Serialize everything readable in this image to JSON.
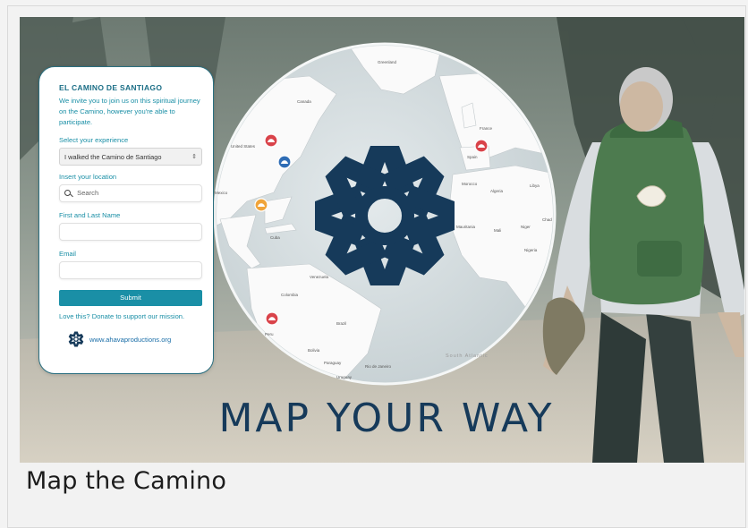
{
  "caption": "Map the Camino",
  "headline": "MAP YOUR WAY",
  "form": {
    "title": "EL CAMINO DE SANTIAGO",
    "intro": "We invite you to join us on this spiritual journey on the Camino, however you're able to participate.",
    "experience_label": "Select your experience",
    "experience_value": "I walked the Camino de Santiago",
    "location_label": "Insert your location",
    "location_placeholder": "Search",
    "name_label": "First and Last Name",
    "name_value": "",
    "email_label": "Email",
    "email_value": "",
    "submit_label": "Submit",
    "donate_text": "Love this? Donate to support our mission.",
    "website": "www.ahavaproductions.org"
  },
  "map": {
    "labels": {
      "greenland": "Greenland",
      "canada": "Canada",
      "united_states": "United States",
      "mexico": "Mexico",
      "cuba": "Cuba",
      "venezuela": "Venezuela",
      "colombia": "Colombia",
      "peru": "Peru",
      "brazil": "Brazil",
      "bolivia": "Bolivia",
      "paraguay": "Paraguay",
      "uruguay": "Uruguay",
      "rio": "Rio de Janeiro",
      "france": "France",
      "spain": "Spain",
      "morocco": "Morocco",
      "algeria": "Algeria",
      "libya": "Libya",
      "mali": "Mali",
      "niger": "Niger",
      "chad": "Chad",
      "mauritania": "Mauritania",
      "nigeria": "Nigeria",
      "south_atlantic": "South Atlantic"
    },
    "logo_icon": "ahava-star-logo",
    "marker_icon": "shell-pin-icon"
  },
  "colors": {
    "brand_navy": "#163a5a",
    "brand_teal": "#1a8fa6",
    "marker_red": "#d9434a",
    "marker_orange": "#f0a43a",
    "marker_blue": "#2f6db5"
  }
}
